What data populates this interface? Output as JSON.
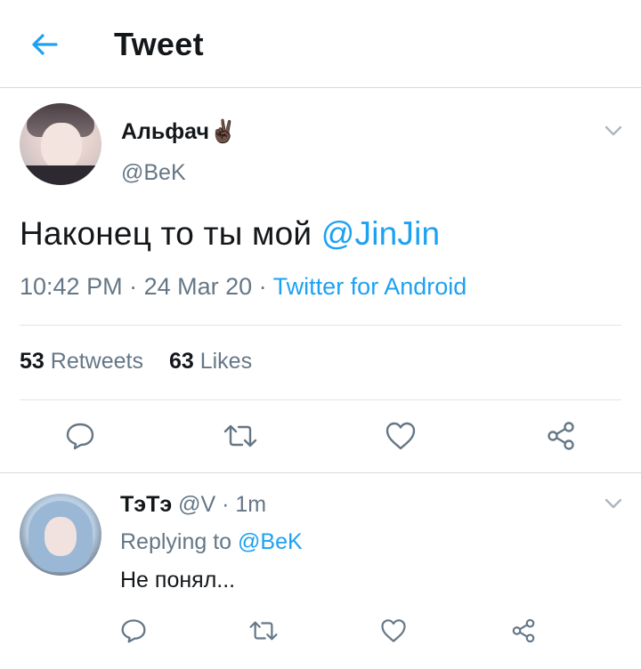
{
  "header": {
    "title": "Tweet",
    "back_icon": "arrow-left-icon",
    "accent": "#1da1f2"
  },
  "tweet": {
    "display_name": "Альфач",
    "name_emoji": "✌🏿",
    "handle": "@BeK",
    "text_before_mention": "Наконец то ты мой ",
    "mention": "@JinJin",
    "time": "10:42 PM",
    "date": "24 Mar 20",
    "source": "Twitter for Android",
    "retweets_count": "53",
    "retweets_label": "Retweets",
    "likes_count": "63",
    "likes_label": "Likes",
    "actions": [
      "reply-icon",
      "retweet-icon",
      "like-icon",
      "share-icon"
    ]
  },
  "reply": {
    "display_name": "ТэТэ",
    "handle": "@V",
    "time": "1m",
    "replying_prefix": "Replying to ",
    "replying_to": "@BeK",
    "text": "Не понял...",
    "actions": [
      "reply-icon",
      "retweet-icon",
      "like-icon",
      "share-icon"
    ]
  },
  "colors": {
    "link": "#1da1f2",
    "muted": "#657786",
    "text": "#14171a",
    "border": "#d9d9d9"
  }
}
